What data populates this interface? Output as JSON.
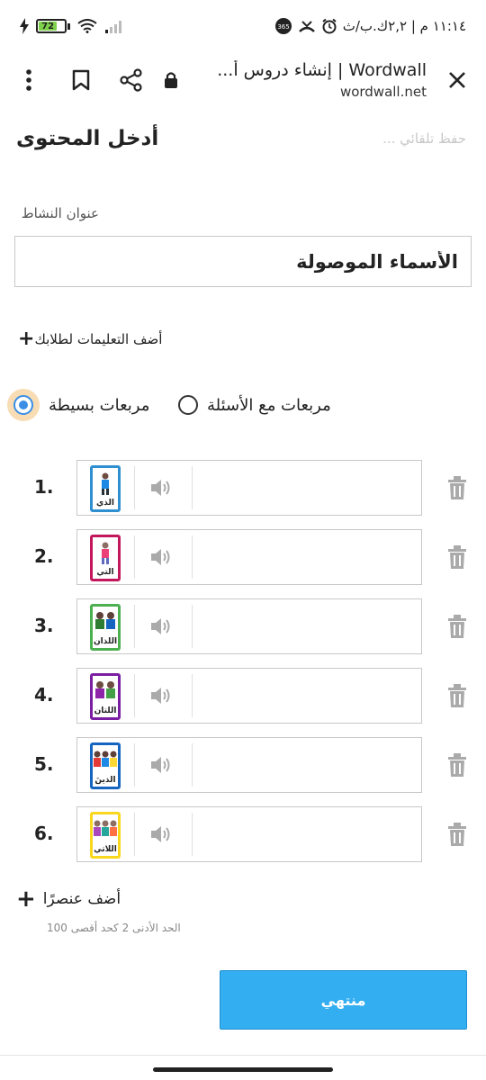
{
  "status_bar": {
    "time_date": "١١:١٤ م | ٢,٢ك.ب/ث",
    "battery": "72",
    "network_badge": "365"
  },
  "browser": {
    "title": "Wordwall | إنشاء دروس أ...",
    "url": "wordwall.net"
  },
  "header": {
    "autosave": "... حفظ تلقائي",
    "title": "أدخل المحتوى"
  },
  "activity": {
    "label": "عنوان النشاط",
    "value": "الأسماء الموصولة"
  },
  "instructions_link": "أضف التعليمات لطلابك",
  "options": [
    {
      "label": "مربعات مع الأسئلة",
      "selected": false
    },
    {
      "label": "مربعات بسيطة",
      "selected": true
    }
  ],
  "items": [
    {
      "number": "1.",
      "word": "الذي",
      "border": "#2f8fd0"
    },
    {
      "number": "2.",
      "word": "التي",
      "border": "#c2185b"
    },
    {
      "number": "3.",
      "word": "اللذان",
      "border": "#4caf50"
    },
    {
      "number": "4.",
      "word": "اللتان",
      "border": "#7b1fa2"
    },
    {
      "number": "5.",
      "word": "الذينَ",
      "border": "#1565c0"
    },
    {
      "number": "6.",
      "word": "اللاتي",
      "border": "#f9d71c"
    }
  ],
  "add_item": "أضف عنصرًا",
  "limits": "الحد الأدنى 2 كحد أقصى 100",
  "done_button": "منتهي",
  "colors": {
    "accent": "#33aef0",
    "radio_selected": "#3a8ee6",
    "radio_highlight": "#f8dcb4"
  }
}
